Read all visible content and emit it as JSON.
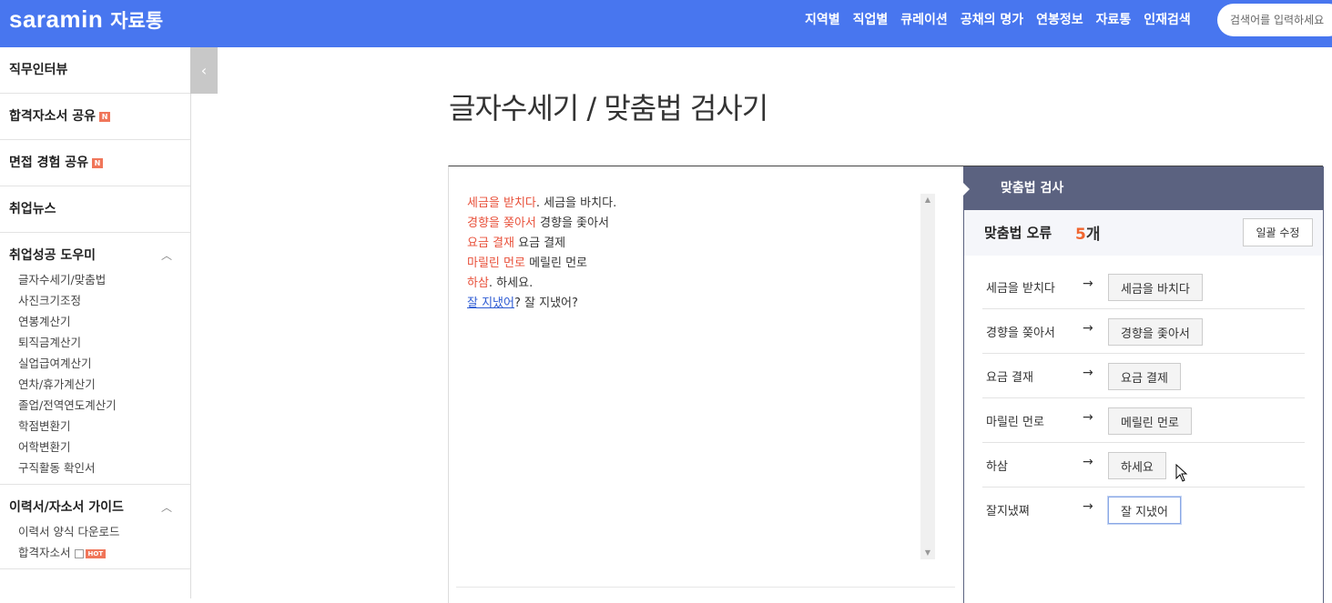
{
  "header": {
    "logo": "saramin",
    "logo_sub": "자료통",
    "nav": [
      "지역별",
      "직업별",
      "큐레이션",
      "공채의 명가",
      "연봉정보",
      "자료통",
      "인재검색"
    ],
    "search_placeholder": "검색어를 입력하세요"
  },
  "sidebar": {
    "sections": [
      {
        "label": "직무인터뷰"
      },
      {
        "label": "합격자소서 공유",
        "badge": "N"
      },
      {
        "label": "면접 경험 공유",
        "badge": "N"
      },
      {
        "label": "취업뉴스"
      },
      {
        "label": "취업성공 도우미",
        "items": [
          "글자수세기/맞춤법",
          "사진크기조정",
          "연봉계산기",
          "퇴직금계산기",
          "실업급여계산기",
          "연차/휴가계산기",
          "졸업/전역연도계산기",
          "학점변환기",
          "어학변환기",
          "구직활동 확인서"
        ]
      },
      {
        "label": "이력서/자소서 가이드",
        "items": [
          "이력서 양식 다운로드",
          "합격자소서"
        ],
        "hot": "HOT"
      }
    ]
  },
  "main": {
    "title": "글자수세기 / 맞춤법 검사기",
    "editor_lines": [
      {
        "err": "세금을 받치다",
        "rest": ". 세금을 바치다."
      },
      {
        "err": "경향을 쫒아서",
        "rest": " 경향을 좇아서"
      },
      {
        "err": "요금 결재",
        "rest": " 요금 결제"
      },
      {
        "err": "마릴린 먼로",
        "rest": " 메릴린 먼로"
      },
      {
        "err": "하삼",
        "rest": ". 하세요."
      },
      {
        "err": "잘 지냈어",
        "rest": "? 잘 지냈어?"
      }
    ]
  },
  "panel": {
    "title": "맞춤법 검사",
    "error_label": "맞춤법 오류",
    "error_count": "5",
    "error_unit": "개",
    "fix_all": "일괄 수정",
    "arrow": "→",
    "corrections": [
      {
        "wrong": "세금을 받치다",
        "right": "세금을 바치다"
      },
      {
        "wrong": "경향을 쫒아서",
        "right": "경향을 좇아서"
      },
      {
        "wrong": "요금 결재",
        "right": "요금 결제"
      },
      {
        "wrong": "마릴린 먼로",
        "right": "메릴린 먼로"
      },
      {
        "wrong": "하삼",
        "right": "하세요"
      },
      {
        "wrong": "잘지냈쪄",
        "right": "잘 지냈어"
      }
    ]
  },
  "colors": {
    "header": "#4876ef",
    "panel": "#5b6280",
    "error": "#e8503a",
    "count": "#f0652f"
  }
}
